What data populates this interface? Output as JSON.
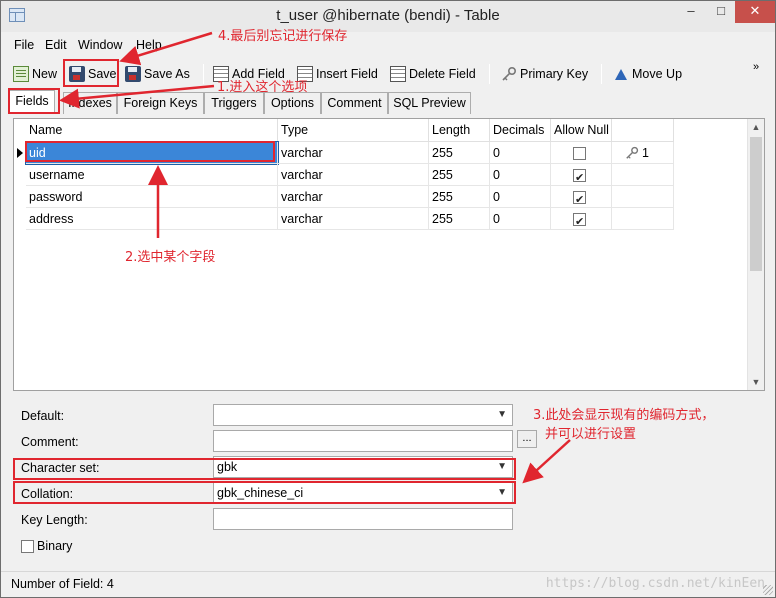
{
  "window": {
    "title": "t_user @hibernate (bendi) - Table",
    "min": "–",
    "max": "□",
    "close": "✕"
  },
  "menu": [
    "File",
    "Edit",
    "Window",
    "Help"
  ],
  "toolbar": {
    "new": "New",
    "save": "Save",
    "save_as": "Save As",
    "add_field": "Add Field",
    "insert_field": "Insert Field",
    "delete_field": "Delete Field",
    "primary_key": "Primary Key",
    "move_up": "Move Up",
    "overflow": "»"
  },
  "tabs": [
    "Fields",
    "Indexes",
    "Foreign Keys",
    "Triggers",
    "Options",
    "Comment",
    "SQL Preview"
  ],
  "grid": {
    "columns": [
      "Name",
      "Type",
      "Length",
      "Decimals",
      "Allow Null",
      ""
    ],
    "rows": [
      {
        "name": "uid",
        "type": "varchar",
        "length": "255",
        "decimals": "0",
        "allow_null": false,
        "key": "1"
      },
      {
        "name": "username",
        "type": "varchar",
        "length": "255",
        "decimals": "0",
        "allow_null": true,
        "key": ""
      },
      {
        "name": "password",
        "type": "varchar",
        "length": "255",
        "decimals": "0",
        "allow_null": true,
        "key": ""
      },
      {
        "name": "address",
        "type": "varchar",
        "length": "255",
        "decimals": "0",
        "allow_null": true,
        "key": ""
      }
    ]
  },
  "properties": {
    "default_label": "Default:",
    "default_value": "",
    "comment_label": "Comment:",
    "comment_value": "",
    "ellipsis": "...",
    "charset_label": "Character set:",
    "charset_value": "gbk",
    "collation_label": "Collation:",
    "collation_value": "gbk_chinese_ci",
    "keylength_label": "Key Length:",
    "keylength_value": "",
    "binary_label": "Binary"
  },
  "status": {
    "text": "Number of Field: 4",
    "watermark": "https://blog.csdn.net/kinEen"
  },
  "annotations": {
    "a1": "1.进入这个选项",
    "a2": "2.选中某个字段",
    "a3_line1": "3.此处会显示现有的编码方式，",
    "a3_line2": "并可以进行设置",
    "a4": "4.最后别忘记进行保存",
    "color": "#e0262f"
  }
}
